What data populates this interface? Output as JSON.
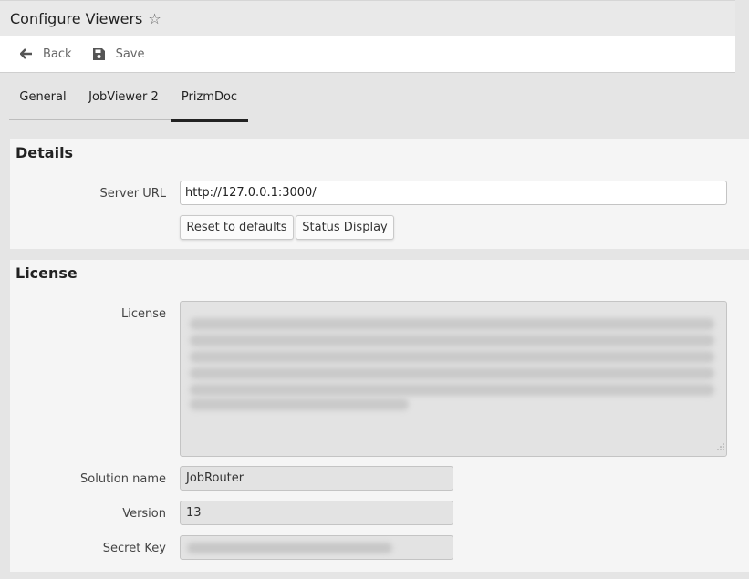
{
  "header": {
    "title": "Configure Viewers",
    "favorite_icon": "star-outline-icon"
  },
  "toolbar": {
    "back_label": "Back",
    "back_icon": "arrow-left-icon",
    "save_label": "Save",
    "save_icon": "floppy-disk-icon"
  },
  "tabs": [
    {
      "label": "General",
      "active": false
    },
    {
      "label": "JobViewer 2",
      "active": false
    },
    {
      "label": "PrizmDoc",
      "active": true
    }
  ],
  "details": {
    "heading": "Details",
    "server_url_label": "Server URL",
    "server_url_value": "http://127.0.0.1:3000/",
    "reset_button": "Reset to defaults",
    "status_button": "Status Display"
  },
  "license": {
    "heading": "License",
    "license_label": "License",
    "solution_label": "Solution name",
    "solution_value": "JobRouter",
    "version_label": "Version",
    "version_value": "13",
    "secret_label": "Secret Key"
  }
}
